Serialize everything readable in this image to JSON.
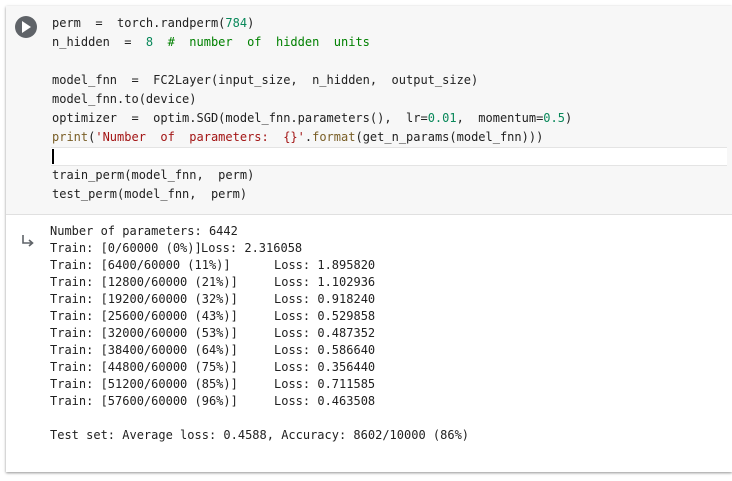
{
  "cell": {
    "code": {
      "line1": [
        "perm  =  torch.randperm(",
        "784",
        ")"
      ],
      "line2": [
        "n_hidden  =  ",
        "8",
        "  ",
        "#  number  of  hidden  units"
      ],
      "line4": "model_fnn  =  FC2Layer(input_size,  n_hidden,  output_size)",
      "line5": "model_fnn.to(device)",
      "line6": [
        "optimizer  =  optim.SGD(model_fnn.parameters(),  lr=",
        "0.01",
        ",  momentum=",
        "0.5",
        ")"
      ],
      "line7": [
        "print",
        "(",
        "'Number  of  parameters:  {}'",
        ".",
        "format",
        "(get_n_params(model_fnn)))"
      ],
      "line9": "train_perm(model_fnn,  perm)",
      "line10": "test_perm(model_fnn,  perm)"
    },
    "output": {
      "param_count": "Number of parameters: 6442",
      "train_rows": [
        {
          "label": "Train: [0/60000 (0%)]",
          "loss": "Loss: 2.316058"
        },
        {
          "label": "Train: [6400/60000 (11%)]",
          "loss": "Loss: 1.895820"
        },
        {
          "label": "Train: [12800/60000 (21%)]",
          "loss": "Loss: 1.102936"
        },
        {
          "label": "Train: [19200/60000 (32%)]",
          "loss": "Loss: 0.918240"
        },
        {
          "label": "Train: [25600/60000 (43%)]",
          "loss": "Loss: 0.529858"
        },
        {
          "label": "Train: [32000/60000 (53%)]",
          "loss": "Loss: 0.487352"
        },
        {
          "label": "Train: [38400/60000 (64%)]",
          "loss": "Loss: 0.586640"
        },
        {
          "label": "Train: [44800/60000 (75%)]",
          "loss": "Loss: 0.356440"
        },
        {
          "label": "Train: [51200/60000 (85%)]",
          "loss": "Loss: 0.711585"
        },
        {
          "label": "Train: [57600/60000 (96%)]",
          "loss": "Loss: 0.463508"
        }
      ],
      "test_result": "Test set: Average loss: 0.4588, Accuracy: 8602/10000 (86%)"
    }
  },
  "icons": {
    "run": "play-icon",
    "output": "output-arrow-icon"
  },
  "colors": {
    "number": "#09885a",
    "comment": "#008000",
    "builtin": "#795e26",
    "string": "#a31515",
    "code_bg": "#f7f7f7"
  }
}
